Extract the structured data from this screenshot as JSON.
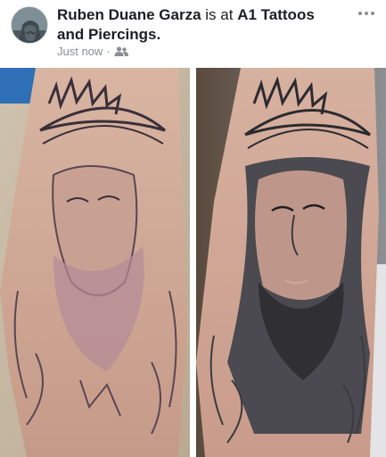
{
  "post": {
    "author": "Ruben Duane Garza",
    "verb": "is at",
    "place": "A1 Tattoos and Piercings.",
    "timestamp": "Just now",
    "separator": "·",
    "audience_icon": "friends-icon",
    "more_icon": "more-dots-icon"
  },
  "photos": [
    {
      "name": "before-photo",
      "subject": "tattoo-before"
    },
    {
      "name": "after-photo",
      "subject": "tattoo-after"
    }
  ],
  "colors": {
    "text_primary": "#1c1e21",
    "text_secondary": "#8a8d91",
    "background": "#ffffff"
  }
}
